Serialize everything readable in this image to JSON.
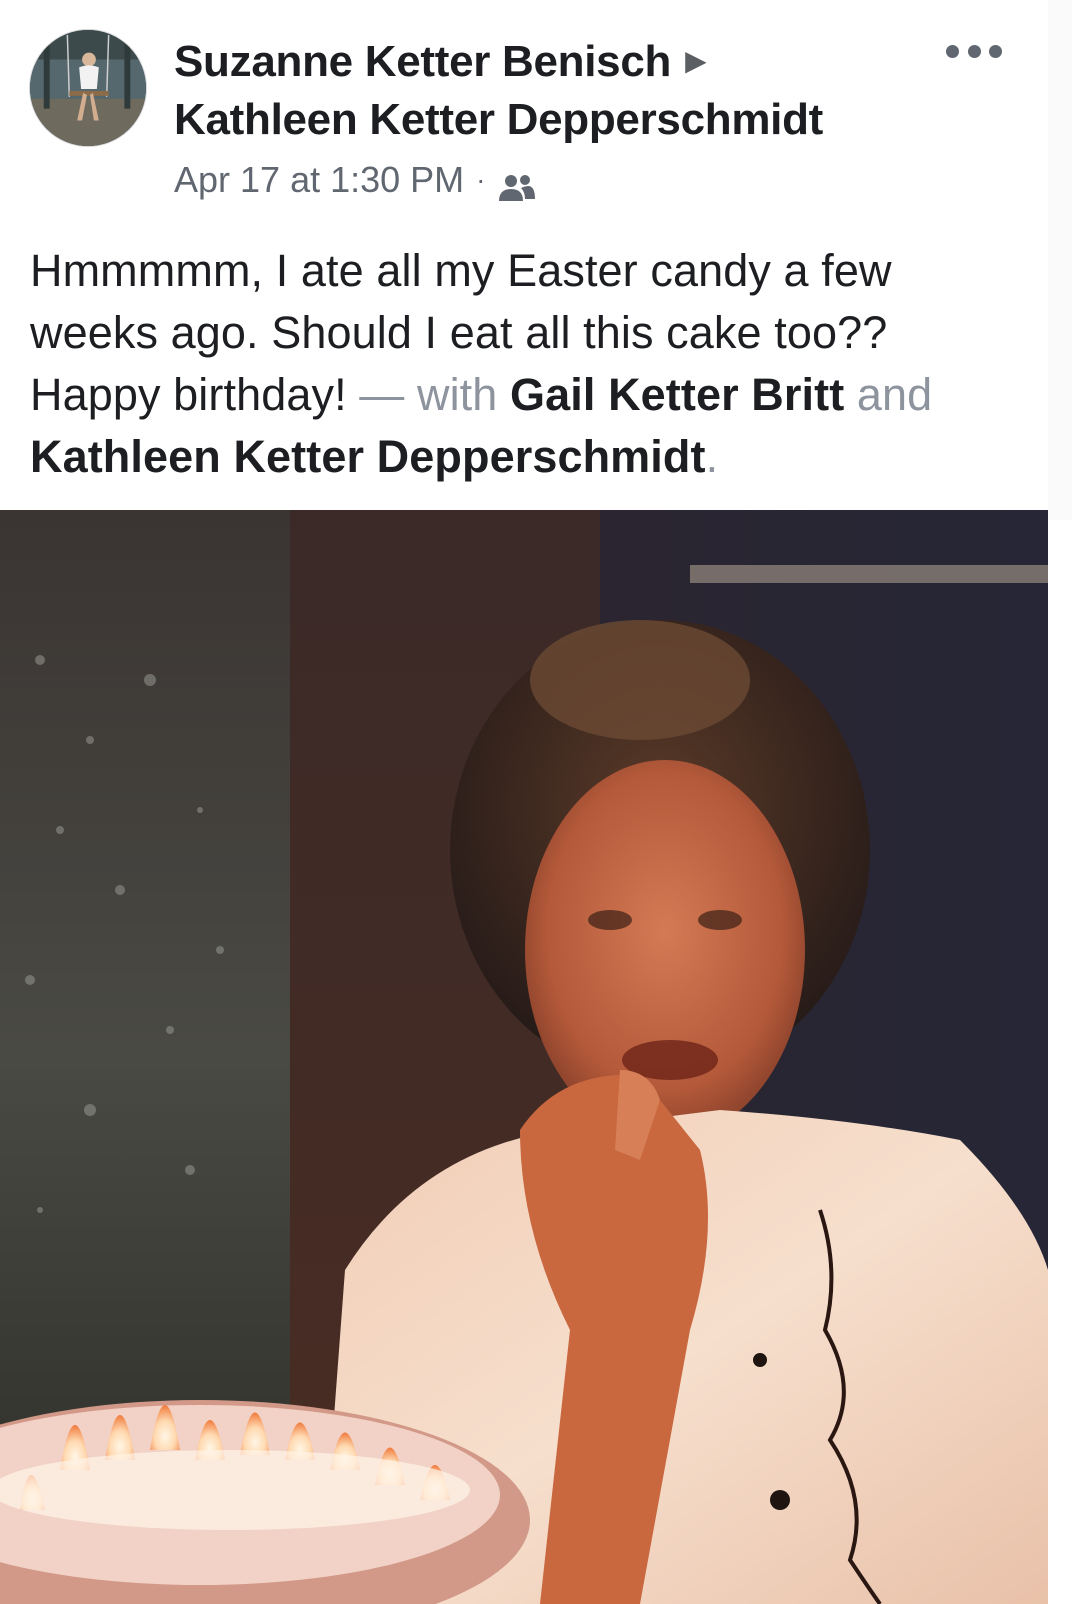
{
  "post": {
    "author": "Suzanne Ketter Benisch",
    "arrow": "▶",
    "recipient": "Kathleen Ketter Depperschmidt",
    "timestamp": "Apr 17 at 1:30 PM",
    "separator": "·",
    "audience_icon": "friends-icon",
    "more_icon": "more-options-icon",
    "text": {
      "body_line1": "Hmmmmm, I ate all my Easter candy a few",
      "body_line2": "weeks ago. Should I eat all this cake too??",
      "body_line3": "Happy birthday!",
      "with_prefix": " — with ",
      "tag1": "Gail Ketter Britt",
      "and": " and",
      "tag2": "Kathleen Ketter Depperschmidt",
      "period": "."
    }
  },
  "colors": {
    "name_text": "#1c1e21",
    "meta_text": "#616770",
    "muted_text": "#8d949e"
  }
}
